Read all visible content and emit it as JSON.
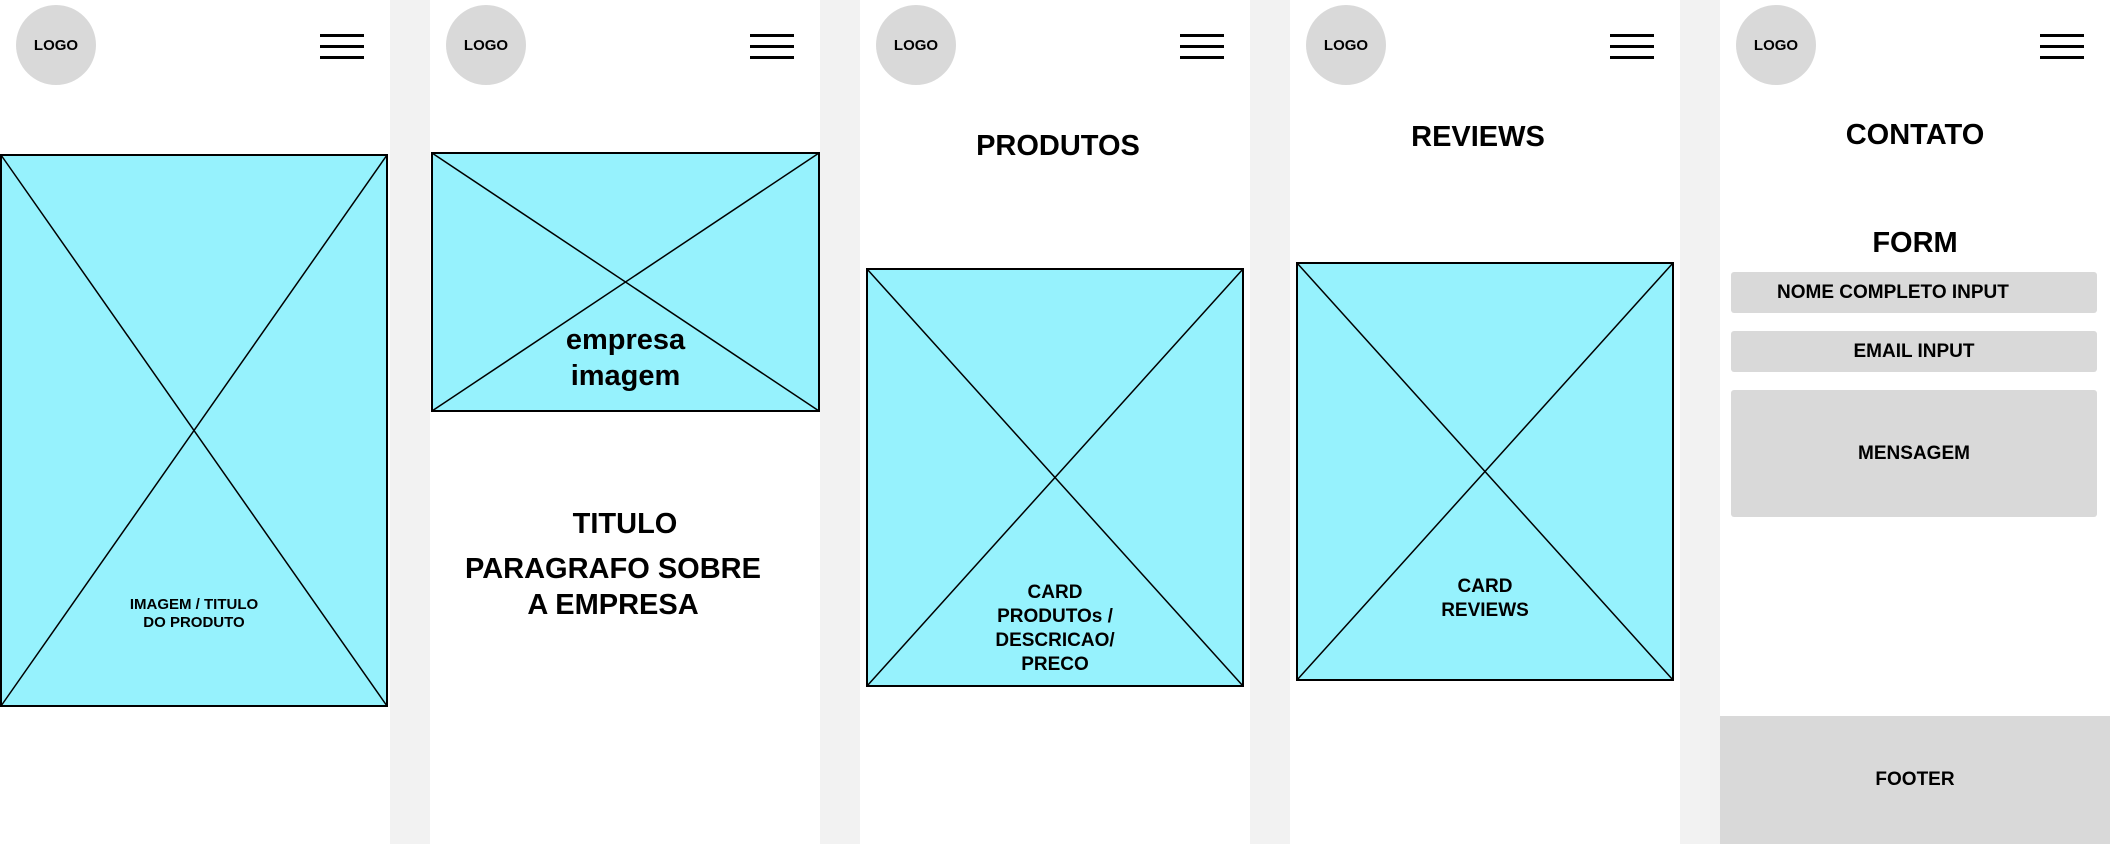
{
  "logo_label": "LOGO",
  "colors": {
    "placeholder": "#96f2fd",
    "gray": "#d9d9d9",
    "background": "#f2f2f2"
  },
  "icons": {
    "menu": "hamburger-menu-icon",
    "image": "image-placeholder-cross"
  },
  "screens": {
    "home": {
      "image_label": "IMAGEM / TITULO\nDO PRODUTO"
    },
    "about": {
      "image_label": "empresa\nimagem",
      "title": "TITULO",
      "paragraph": "PARAGRAFO SOBRE\nA EMPRESA"
    },
    "products": {
      "title": "PRODUTOS",
      "card_label": "CARD\nPRODUTOs /\nDESCRICAO/\nPRECO"
    },
    "reviews": {
      "title": "REVIEWS",
      "card_label": "CARD\nREVIEWS"
    },
    "contact": {
      "title": "CONTATO",
      "form_title": "FORM",
      "name_input": "NOME COMPLETO INPUT",
      "email_input": "EMAIL INPUT",
      "message_input": "MENSAGEM",
      "footer": "FOOTER"
    }
  }
}
